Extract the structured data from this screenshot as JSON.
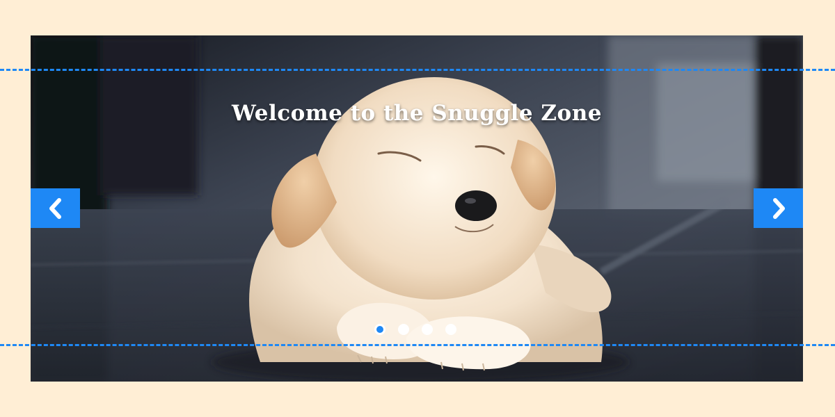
{
  "carousel": {
    "caption": "Welcome to the Snuggle Zone",
    "slide_image": "sleeping-golden-retriever-puppy",
    "prev_icon": "chevron-left-icon",
    "next_icon": "chevron-right-icon",
    "slide_count": 4,
    "active_slide": 1
  },
  "colors": {
    "page_background": "#ffeed5",
    "accent": "#1e88f5",
    "caption_text": "#ffffff"
  }
}
